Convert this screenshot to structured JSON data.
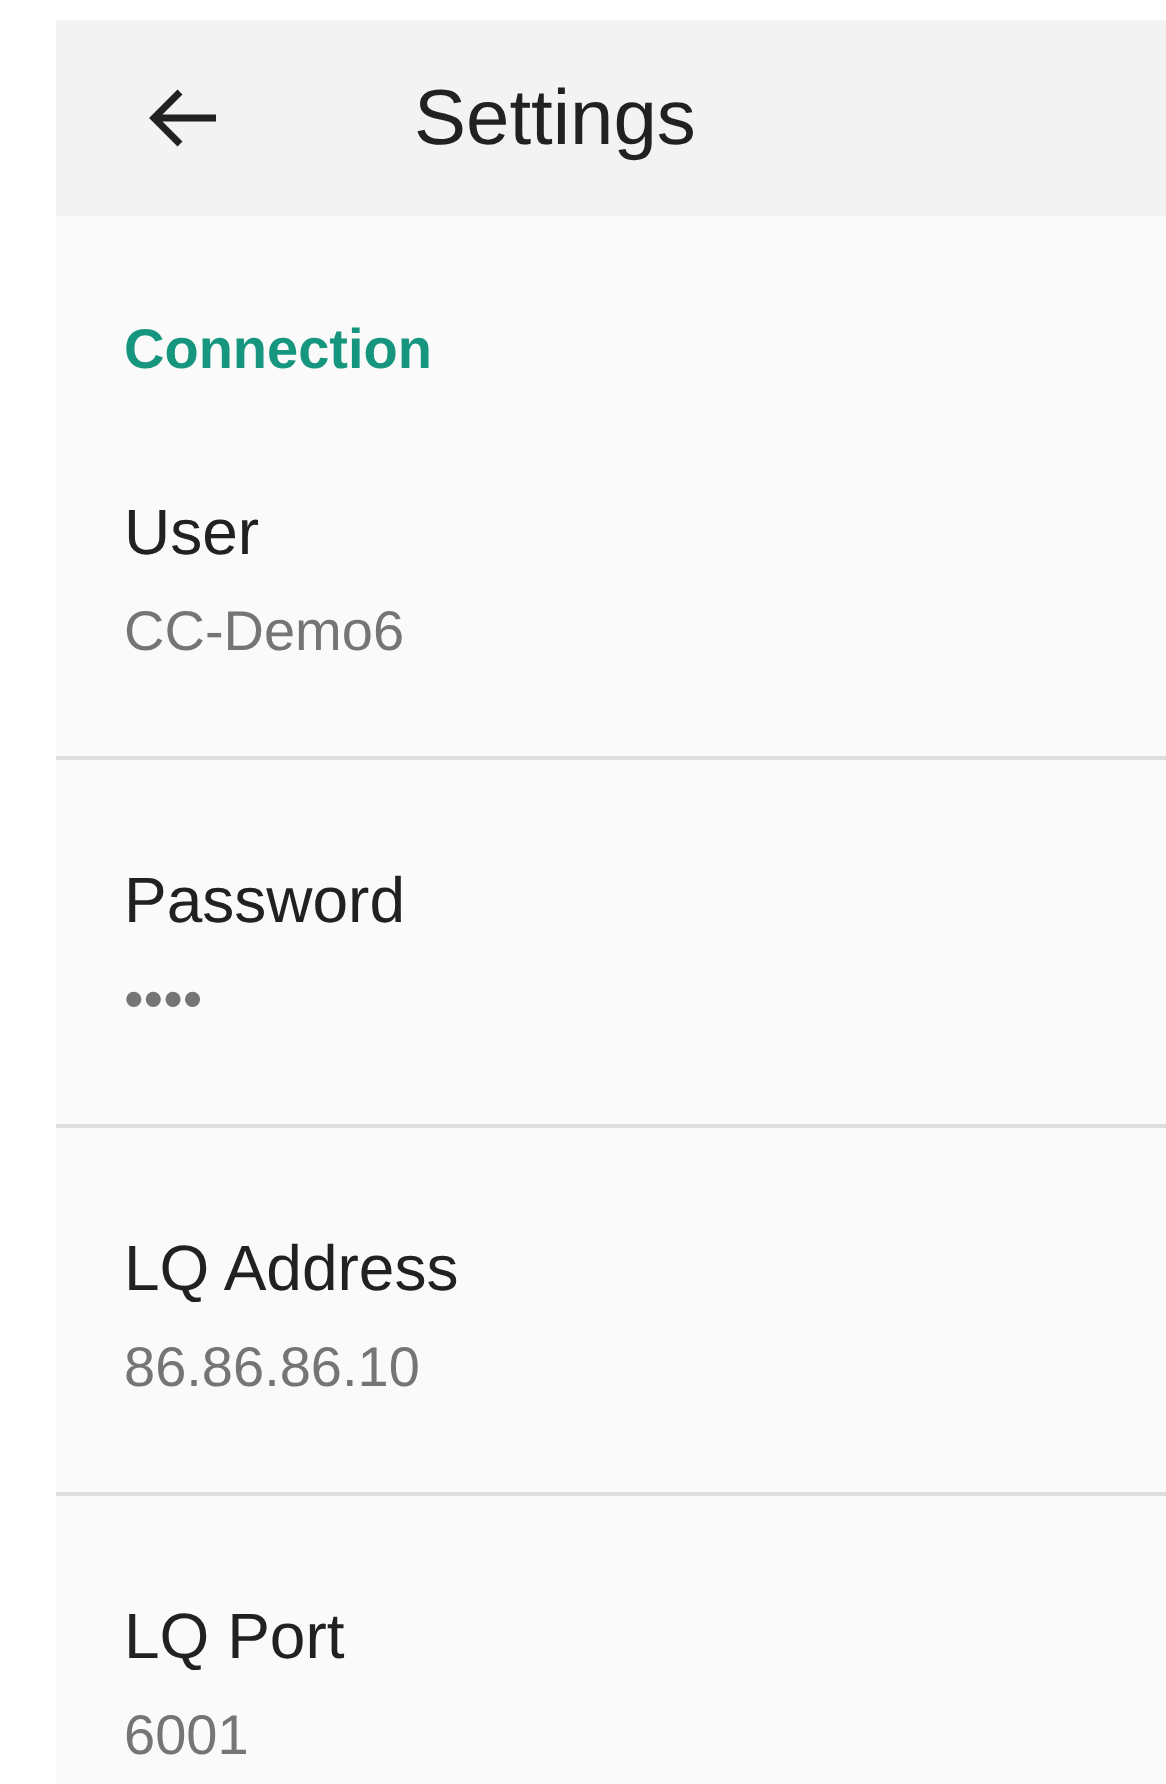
{
  "app_bar": {
    "title": "Settings"
  },
  "section": {
    "title": "Connection"
  },
  "preferences": [
    {
      "title": "User",
      "summary": "CC-Demo6"
    },
    {
      "title": "Password",
      "summary": "••••"
    },
    {
      "title": "LQ Address",
      "summary": "86.86.86.10"
    },
    {
      "title": "LQ Port",
      "summary": "6001"
    }
  ]
}
